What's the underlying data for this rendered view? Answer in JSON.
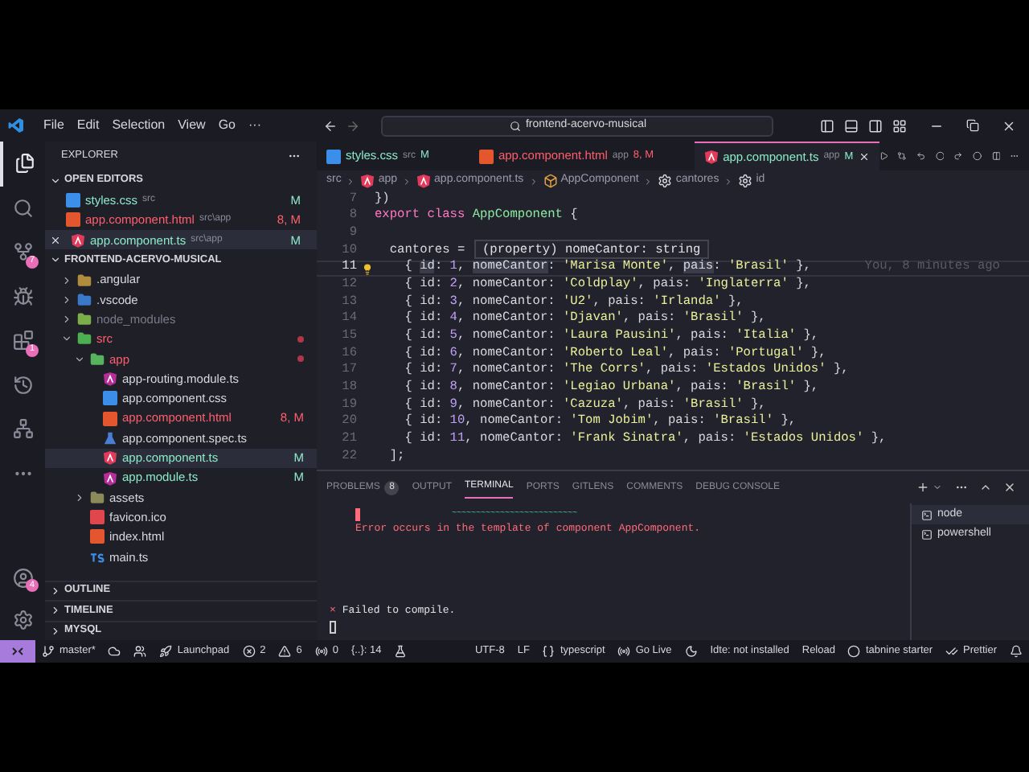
{
  "title_bar": {
    "menus": [
      "File",
      "Edit",
      "Selection",
      "View",
      "Go",
      "···"
    ],
    "search": "frontend-acervo-musical"
  },
  "activity_bar": [
    {
      "kind": "files",
      "selected": true
    },
    {
      "kind": "search",
      "selected": false
    },
    {
      "kind": "scm",
      "selected": false,
      "badge": "7"
    },
    {
      "kind": "debug",
      "selected": false
    },
    {
      "kind": "extensions",
      "selected": false,
      "badge": "1"
    },
    {
      "kind": "history",
      "selected": false
    },
    {
      "kind": "graph",
      "selected": false
    },
    {
      "kind": "more",
      "selected": false
    }
  ],
  "activity_bottom": [
    {
      "kind": "account",
      "badge": "4"
    },
    {
      "kind": "settings"
    }
  ],
  "sidebar": {
    "title": "EXPLORER",
    "open_editors_title": "OPEN EDITORS",
    "open_editors": [
      {
        "kind": "css",
        "name": "styles.css",
        "path": "src",
        "color": "#8be9c8",
        "badge": "M",
        "selected": false
      },
      {
        "kind": "html",
        "name": "app.component.html",
        "path": "src\\app",
        "color": "#ff5f6d",
        "badge": "8, M",
        "selected": false
      },
      {
        "kind": "angular",
        "name": "app.component.ts",
        "path": "src\\app",
        "color": "#8be9c8",
        "badge": "M",
        "selected": true
      }
    ],
    "project_title": "FRONTEND-ACERVO-MUSICAL",
    "tree": [
      {
        "kind": "folder-angular",
        "name": ".angular",
        "color": "#d6d6dc",
        "dot": false,
        "selected": false,
        "expanded": false
      },
      {
        "kind": "folder-vscode",
        "name": ".vscode",
        "color": "#d6d6dc",
        "dot": false,
        "selected": false,
        "expanded": false
      },
      {
        "kind": "folder-node",
        "name": "node_modules",
        "color": "#7a7a88",
        "dot": false,
        "selected": false,
        "expanded": false
      },
      {
        "kind": "folder-src",
        "name": "src",
        "color": "#ff5f6d",
        "dot": true,
        "selected": false,
        "expanded": true,
        "children": [
          {
            "kind": "folder-app",
            "name": "app",
            "color": "#ff5f6d",
            "dot": true,
            "selected": false,
            "expanded": true,
            "children": [
              {
                "kind": "angular-module",
                "name": "app-routing.module.ts",
                "color": "#d6d6dc",
                "dot": false,
                "selected": false
              },
              {
                "kind": "css",
                "name": "app.component.css",
                "color": "#d6d6dc",
                "dot": false,
                "selected": false
              },
              {
                "kind": "html",
                "name": "app.component.html",
                "color": "#ff5f6d",
                "badge": "8, M",
                "dot": false,
                "selected": false
              },
              {
                "kind": "spec",
                "name": "app.component.spec.ts",
                "color": "#d6d6dc",
                "dot": false,
                "selected": false
              },
              {
                "kind": "angular",
                "name": "app.component.ts",
                "color": "#8be9c8",
                "badge": "M",
                "dot": false,
                "selected": true
              },
              {
                "kind": "angular-module",
                "name": "app.module.ts",
                "color": "#8be9c8",
                "badge": "M",
                "dot": false,
                "selected": false
              }
            ]
          },
          {
            "kind": "folder-assets",
            "name": "assets",
            "color": "#d6d6dc",
            "dot": false,
            "selected": false,
            "expanded": false
          },
          {
            "kind": "favicon",
            "name": "favicon.ico",
            "color": "#d6d6dc",
            "dot": false,
            "selected": false
          },
          {
            "kind": "html",
            "name": "index.html",
            "color": "#d6d6dc",
            "dot": false,
            "selected": false
          },
          {
            "kind": "ts",
            "name": "main.ts",
            "color": "#d6d6dc",
            "dot": false,
            "selected": false
          }
        ]
      }
    ],
    "sections": [
      "OUTLINE",
      "TIMELINE",
      "MYSQL"
    ]
  },
  "editor_tabs": [
    {
      "kind": "css",
      "name": "styles.css",
      "path": "src",
      "badge": "M",
      "color": "#8be9c8",
      "selected": false
    },
    {
      "kind": "html",
      "name": "app.component.html",
      "path": "app",
      "badge": "8, M",
      "color": "#ff5f6d",
      "selected": false
    },
    {
      "kind": "angular",
      "name": "app.component.ts",
      "path": "app",
      "badge": "M",
      "color": "#8be9c8",
      "selected": true
    }
  ],
  "breadcrumb": [
    {
      "text": "src"
    },
    {
      "kind": "angular",
      "text": "app"
    },
    {
      "kind": "angular",
      "text": "app.component.ts"
    },
    {
      "kind": "class",
      "text": "AppComponent"
    },
    {
      "kind": "property",
      "text": "cantores"
    },
    {
      "kind": "property",
      "text": "id"
    }
  ],
  "code": [
    {
      "number": "7",
      "current": false,
      "tokens": [
        {
          "kind": "plain",
          "text": "})"
        }
      ]
    },
    {
      "number": "8",
      "current": false,
      "tokens": [
        {
          "kind": "keyword",
          "text": "export class "
        },
        {
          "kind": "class",
          "text": "AppComponent"
        },
        {
          "kind": "plain",
          "text": " {"
        }
      ]
    },
    {
      "number": "9",
      "current": false
    },
    {
      "number": "10",
      "current": false,
      "tokens": [
        {
          "kind": "plain",
          "text": "  cantores ="
        }
      ]
    },
    {
      "number": "11",
      "current": true,
      "tokens": [
        {
          "kind": "plain",
          "text": "    { "
        },
        {
          "kind": "prop",
          "text": "id"
        },
        {
          "kind": "plain",
          "text": ": "
        },
        {
          "kind": "number",
          "text": "1"
        },
        {
          "kind": "plain",
          "text": ", "
        },
        {
          "kind": "prop",
          "text": "nomeCantor"
        },
        {
          "kind": "plain",
          "text": ": "
        },
        {
          "kind": "string",
          "text": "'Marisa Monte'"
        },
        {
          "kind": "plain",
          "text": ", "
        },
        {
          "kind": "prop",
          "text": "pais"
        },
        {
          "kind": "plain",
          "text": ": "
        },
        {
          "kind": "string",
          "text": "'Brasil'"
        },
        {
          "kind": "plain",
          "text": " },"
        }
      ]
    },
    {
      "number": "12",
      "current": false,
      "tokens": [
        {
          "kind": "plain",
          "text": "    { "
        },
        {
          "kind": "prop",
          "text": "id"
        },
        {
          "kind": "plain",
          "text": ": "
        },
        {
          "kind": "number",
          "text": "2"
        },
        {
          "kind": "plain",
          "text": ", "
        },
        {
          "kind": "prop",
          "text": "nomeCantor"
        },
        {
          "kind": "plain",
          "text": ": "
        },
        {
          "kind": "string",
          "text": "'Coldplay'"
        },
        {
          "kind": "plain",
          "text": ", "
        },
        {
          "kind": "prop",
          "text": "pais"
        },
        {
          "kind": "plain",
          "text": ": "
        },
        {
          "kind": "string",
          "text": "'Inglaterra'"
        },
        {
          "kind": "plain",
          "text": " },"
        }
      ]
    },
    {
      "number": "13",
      "current": false,
      "tokens": [
        {
          "kind": "plain",
          "text": "    { "
        },
        {
          "kind": "prop",
          "text": "id"
        },
        {
          "kind": "plain",
          "text": ": "
        },
        {
          "kind": "number",
          "text": "3"
        },
        {
          "kind": "plain",
          "text": ", "
        },
        {
          "kind": "prop",
          "text": "nomeCantor"
        },
        {
          "kind": "plain",
          "text": ": "
        },
        {
          "kind": "string",
          "text": "'U2'"
        },
        {
          "kind": "plain",
          "text": ", "
        },
        {
          "kind": "prop",
          "text": "pais"
        },
        {
          "kind": "plain",
          "text": ": "
        },
        {
          "kind": "string",
          "text": "'Irlanda'"
        },
        {
          "kind": "plain",
          "text": " },"
        }
      ]
    },
    {
      "number": "14",
      "current": false,
      "tokens": [
        {
          "kind": "plain",
          "text": "    { "
        },
        {
          "kind": "prop",
          "text": "id"
        },
        {
          "kind": "plain",
          "text": ": "
        },
        {
          "kind": "number",
          "text": "4"
        },
        {
          "kind": "plain",
          "text": ", "
        },
        {
          "kind": "prop",
          "text": "nomeCantor"
        },
        {
          "kind": "plain",
          "text": ": "
        },
        {
          "kind": "string",
          "text": "'Djavan'"
        },
        {
          "kind": "plain",
          "text": ", "
        },
        {
          "kind": "prop",
          "text": "pais"
        },
        {
          "kind": "plain",
          "text": ": "
        },
        {
          "kind": "string",
          "text": "'Brasil'"
        },
        {
          "kind": "plain",
          "text": " },"
        }
      ]
    },
    {
      "number": "15",
      "current": false,
      "tokens": [
        {
          "kind": "plain",
          "text": "    { "
        },
        {
          "kind": "prop",
          "text": "id"
        },
        {
          "kind": "plain",
          "text": ": "
        },
        {
          "kind": "number",
          "text": "5"
        },
        {
          "kind": "plain",
          "text": ", "
        },
        {
          "kind": "prop",
          "text": "nomeCantor"
        },
        {
          "kind": "plain",
          "text": ": "
        },
        {
          "kind": "string",
          "text": "'Laura Pausini'"
        },
        {
          "kind": "plain",
          "text": ", "
        },
        {
          "kind": "prop",
          "text": "pais"
        },
        {
          "kind": "plain",
          "text": ": "
        },
        {
          "kind": "string",
          "text": "'Italia'"
        },
        {
          "kind": "plain",
          "text": " },"
        }
      ]
    },
    {
      "number": "16",
      "current": false,
      "tokens": [
        {
          "kind": "plain",
          "text": "    { "
        },
        {
          "kind": "prop",
          "text": "id"
        },
        {
          "kind": "plain",
          "text": ": "
        },
        {
          "kind": "number",
          "text": "6"
        },
        {
          "kind": "plain",
          "text": ", "
        },
        {
          "kind": "prop",
          "text": "nomeCantor"
        },
        {
          "kind": "plain",
          "text": ": "
        },
        {
          "kind": "string",
          "text": "'Roberto Leal'"
        },
        {
          "kind": "plain",
          "text": ", "
        },
        {
          "kind": "prop",
          "text": "pais"
        },
        {
          "kind": "plain",
          "text": ": "
        },
        {
          "kind": "string",
          "text": "'Portugal'"
        },
        {
          "kind": "plain",
          "text": " },"
        }
      ]
    },
    {
      "number": "17",
      "current": false,
      "tokens": [
        {
          "kind": "plain",
          "text": "    { "
        },
        {
          "kind": "prop",
          "text": "id"
        },
        {
          "kind": "plain",
          "text": ": "
        },
        {
          "kind": "number",
          "text": "7"
        },
        {
          "kind": "plain",
          "text": ", "
        },
        {
          "kind": "prop",
          "text": "nomeCantor"
        },
        {
          "kind": "plain",
          "text": ": "
        },
        {
          "kind": "string",
          "text": "'The Corrs'"
        },
        {
          "kind": "plain",
          "text": ", "
        },
        {
          "kind": "prop",
          "text": "pais"
        },
        {
          "kind": "plain",
          "text": ": "
        },
        {
          "kind": "string",
          "text": "'Estados Unidos'"
        },
        {
          "kind": "plain",
          "text": " },"
        }
      ]
    },
    {
      "number": "18",
      "current": false,
      "tokens": [
        {
          "kind": "plain",
          "text": "    { "
        },
        {
          "kind": "prop",
          "text": "id"
        },
        {
          "kind": "plain",
          "text": ": "
        },
        {
          "kind": "number",
          "text": "8"
        },
        {
          "kind": "plain",
          "text": ", "
        },
        {
          "kind": "prop",
          "text": "nomeCantor"
        },
        {
          "kind": "plain",
          "text": ": "
        },
        {
          "kind": "string",
          "text": "'Legiao Urbana'"
        },
        {
          "kind": "plain",
          "text": ", "
        },
        {
          "kind": "prop",
          "text": "pais"
        },
        {
          "kind": "plain",
          "text": ": "
        },
        {
          "kind": "string",
          "text": "'Brasil'"
        },
        {
          "kind": "plain",
          "text": " },"
        }
      ]
    },
    {
      "number": "19",
      "current": false,
      "tokens": [
        {
          "kind": "plain",
          "text": "    { "
        },
        {
          "kind": "prop",
          "text": "id"
        },
        {
          "kind": "plain",
          "text": ": "
        },
        {
          "kind": "number",
          "text": "9"
        },
        {
          "kind": "plain",
          "text": ", "
        },
        {
          "kind": "prop",
          "text": "nomeCantor"
        },
        {
          "kind": "plain",
          "text": ": "
        },
        {
          "kind": "string",
          "text": "'Cazuza'"
        },
        {
          "kind": "plain",
          "text": ", "
        },
        {
          "kind": "prop",
          "text": "pais"
        },
        {
          "kind": "plain",
          "text": ": "
        },
        {
          "kind": "string",
          "text": "'Brasil'"
        },
        {
          "kind": "plain",
          "text": " },"
        }
      ]
    },
    {
      "number": "20",
      "current": false,
      "tokens": [
        {
          "kind": "plain",
          "text": "    { "
        },
        {
          "kind": "prop",
          "text": "id"
        },
        {
          "kind": "plain",
          "text": ": "
        },
        {
          "kind": "number",
          "text": "10"
        },
        {
          "kind": "plain",
          "text": ", "
        },
        {
          "kind": "prop",
          "text": "nomeCantor"
        },
        {
          "kind": "plain",
          "text": ": "
        },
        {
          "kind": "string",
          "text": "'Tom Jobim'"
        },
        {
          "kind": "plain",
          "text": ", "
        },
        {
          "kind": "prop",
          "text": "pais"
        },
        {
          "kind": "plain",
          "text": ": "
        },
        {
          "kind": "string",
          "text": "'Brasil'"
        },
        {
          "kind": "plain",
          "text": " },"
        }
      ]
    },
    {
      "number": "21",
      "current": false,
      "tokens": [
        {
          "kind": "plain",
          "text": "    { "
        },
        {
          "kind": "prop",
          "text": "id"
        },
        {
          "kind": "plain",
          "text": ": "
        },
        {
          "kind": "number",
          "text": "11"
        },
        {
          "kind": "plain",
          "text": ", "
        },
        {
          "kind": "prop",
          "text": "nomeCantor"
        },
        {
          "kind": "plain",
          "text": ": "
        },
        {
          "kind": "string",
          "text": "'Frank Sinatra'"
        },
        {
          "kind": "plain",
          "text": ", "
        },
        {
          "kind": "prop",
          "text": "pais"
        },
        {
          "kind": "plain",
          "text": ": "
        },
        {
          "kind": "string",
          "text": "'Estados Unidos'"
        },
        {
          "kind": "plain",
          "text": " },"
        }
      ]
    },
    {
      "number": "22",
      "current": false,
      "tokens": [
        {
          "kind": "plain",
          "text": "  ];"
        }
      ]
    }
  ],
  "blame": "You, 8 minutes ago",
  "hover": "(property) nomeCantor: string",
  "panel": {
    "tabs": [
      {
        "label": "PROBLEMS",
        "count": "8",
        "selected": false
      },
      {
        "label": "OUTPUT",
        "selected": false
      },
      {
        "label": "TERMINAL",
        "selected": true
      },
      {
        "label": "PORTS",
        "selected": false
      },
      {
        "label": "GITLENS",
        "selected": false
      },
      {
        "label": "COMMENTS",
        "selected": false
      },
      {
        "label": "DEBUG CONSOLE",
        "selected": false
      }
    ],
    "squiggle": "~~~~~~~~~~~~~~~~~~~~~~~~~~",
    "error": "Error occurs in the template of component AppComponent.",
    "failed_mark": "×",
    "failed": "Failed to compile.",
    "terminals": [
      {
        "name": "node",
        "selected": true
      },
      {
        "name": "powershell",
        "selected": false
      }
    ]
  },
  "status_bar": {
    "left": [
      {
        "kind": "branch",
        "text": "master*"
      },
      {
        "kind": "cloud"
      },
      {
        "kind": "liveshare"
      },
      {
        "kind": "rocket",
        "text": "Launchpad"
      },
      {
        "kind": "error",
        "text": "2"
      },
      {
        "kind": "warning",
        "text": "6"
      },
      {
        "kind": "ports",
        "text": "0"
      },
      {
        "kind": "plain",
        "text": "{..}: 14"
      },
      {
        "kind": "flask"
      }
    ],
    "right": [
      {
        "kind": "plain",
        "text": "UTF-8"
      },
      {
        "kind": "plain",
        "text": "LF"
      },
      {
        "kind": "braces",
        "text": "typescript"
      },
      {
        "kind": "radio",
        "text": "Go Live"
      },
      {
        "kind": "moon"
      },
      {
        "kind": "plain",
        "text": "Idte: not installed"
      },
      {
        "kind": "plain",
        "text": "Reload"
      },
      {
        "kind": "tabnine",
        "text": "tabnine starter"
      },
      {
        "kind": "checks",
        "text": "Prettier"
      },
      {
        "kind": "bell"
      }
    ]
  }
}
